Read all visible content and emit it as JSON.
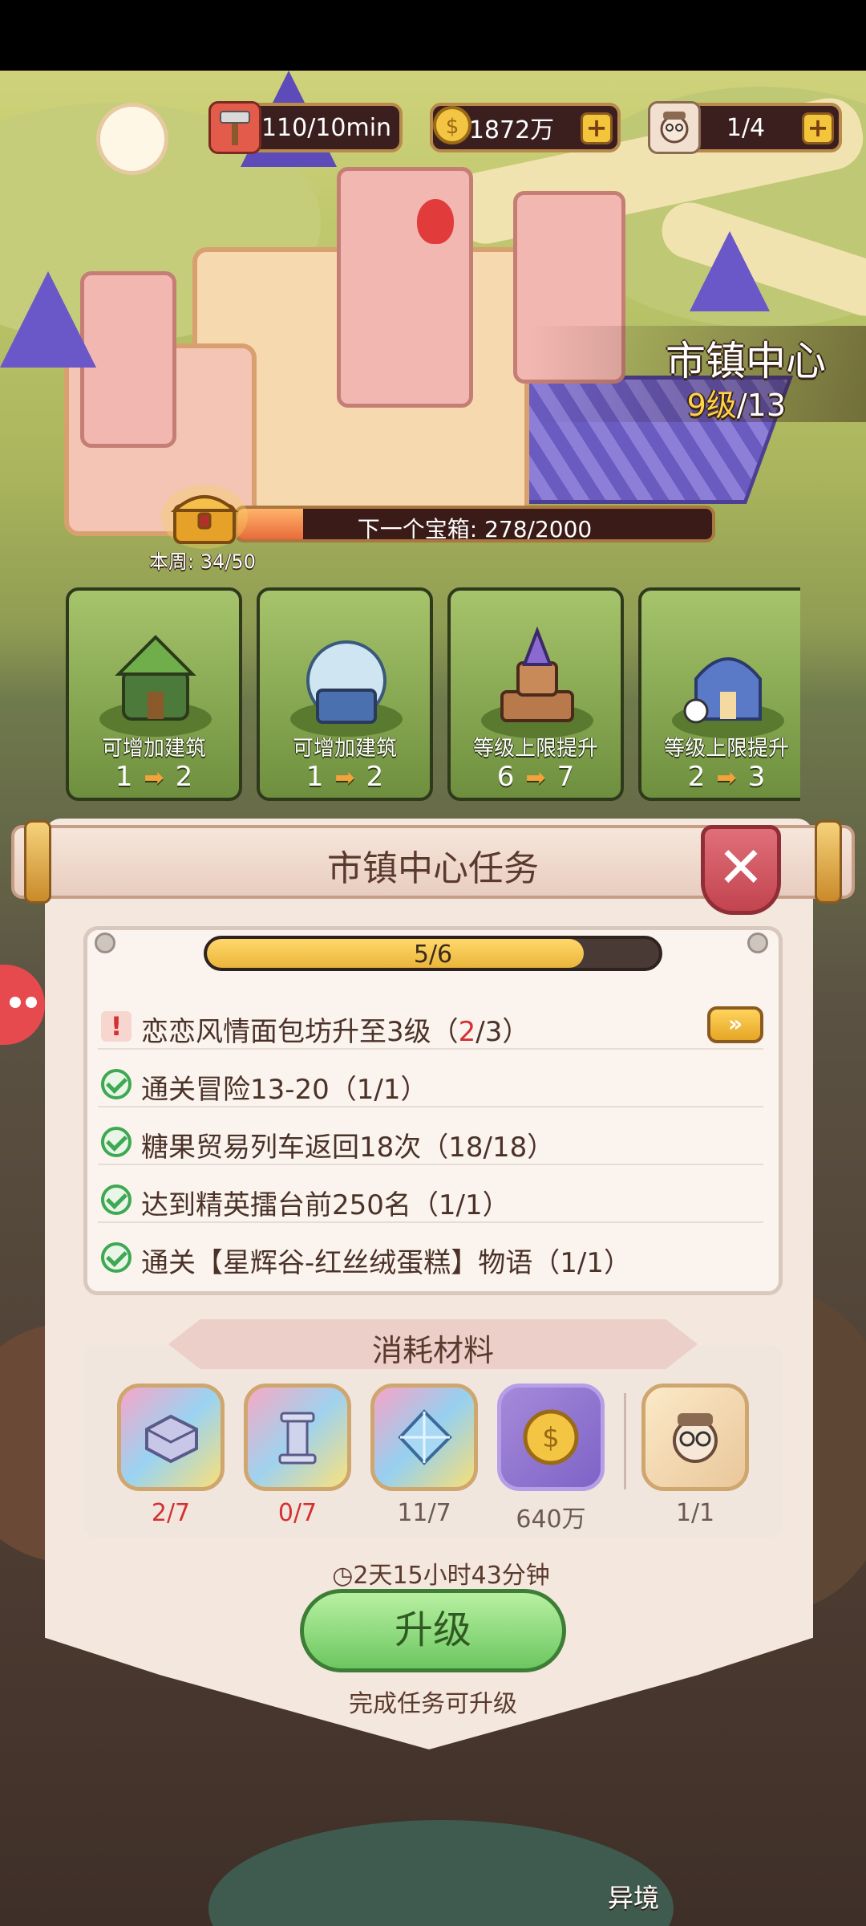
{
  "resources": {
    "stamina": {
      "icon": "hammer-icon",
      "value": "110/10min"
    },
    "coins": {
      "icon": "coin-icon",
      "value": "1872万"
    },
    "workers": {
      "icon": "worker-icon",
      "value": "1/4"
    }
  },
  "building": {
    "name": "市镇中心",
    "level_current": "9级",
    "level_max": "/13"
  },
  "chest": {
    "label": "下一个宝箱: 278/2000",
    "progress": 0.139,
    "week_label": "本周: 34/50"
  },
  "upgrade_cards": [
    {
      "caption": "可增加建筑",
      "from": "1",
      "to": "2"
    },
    {
      "caption": "可增加建筑",
      "from": "1",
      "to": "2"
    },
    {
      "caption": "等级上限提升",
      "from": "6",
      "to": "7"
    },
    {
      "caption": "等级上限提升",
      "from": "2",
      "to": "3"
    }
  ],
  "panel": {
    "title": "市镇中心任务",
    "progress_text": "5/6",
    "progress": 0.8333,
    "quests": [
      {
        "status": "incomplete",
        "text_before": "恋恋风情面包坊升至3级（",
        "text_highlight": "2",
        "text_after": "/3）"
      },
      {
        "status": "done",
        "text": "通关冒险13-20（1/1）"
      },
      {
        "status": "done",
        "text": "糖果贸易列车返回18次（18/18）"
      },
      {
        "status": "done",
        "text": "达到精英擂台前250名（1/1）"
      },
      {
        "status": "done",
        "text": "通关【星辉谷-红丝绒蛋糕】物语（1/1）"
      }
    ],
    "goto_label": "»"
  },
  "materials": {
    "title": "消耗材料",
    "items": [
      {
        "name": "slab-icon",
        "count": "2/7",
        "insufficient": true
      },
      {
        "name": "pillar-icon",
        "count": "0/7",
        "insufficient": true
      },
      {
        "name": "crystal-icon",
        "count": "11/7",
        "insufficient": false
      },
      {
        "name": "coin-icon",
        "count": "640万",
        "insufficient": false
      },
      {
        "name": "worker-icon",
        "count": "1/1",
        "insufficient": false
      }
    ]
  },
  "timer": "2天15小时43分钟",
  "upgrade_button": "升级",
  "upgrade_hint": "完成任务可升级",
  "bottom_label": "异境",
  "colors": {
    "accent_green": "#6cc760",
    "warning_red": "#d43131",
    "gold": "#eab53b"
  }
}
